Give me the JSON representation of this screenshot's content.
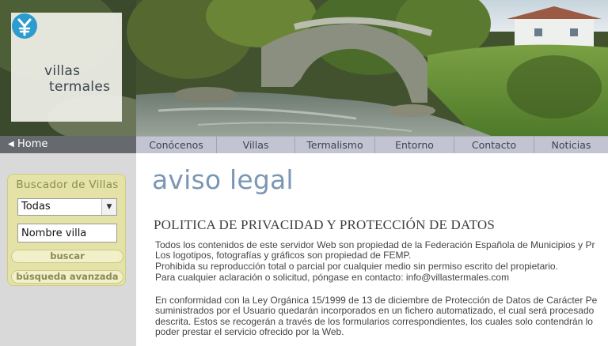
{
  "header": {
    "logo_line1": "villas",
    "logo_line2": "termales"
  },
  "nav": {
    "home_label": "Home",
    "items": [
      "Conócenos",
      "Villas",
      "Termalismo",
      "Entorno",
      "Contacto",
      "Noticias"
    ]
  },
  "sidebar": {
    "search_title": "Buscador de Villas",
    "select_value": "Todas",
    "name_input_value": "Nombre villa",
    "search_button": "buscar",
    "advanced_button": "búsqueda avanzada"
  },
  "main": {
    "title": "aviso legal",
    "heading": "POLITICA DE PRIVACIDAD Y PROTECCIÓN DE DATOS",
    "para1": [
      "Todos los contenidos de este servidor Web son propiedad de la Federación Española de Municipios y Pr",
      "Los logotipos, fotografías y gráficos son propiedad de FEMP.",
      "Prohibida su reproducción total o parcial por cualquier medio sin permiso escrito del propietario.",
      "Para cualquier aclaración o solicitud, póngase en contacto: info@villastermales.com"
    ],
    "para2": [
      "En conformidad con la Ley Orgánica 15/1999 de 13 de diciembre de Protección de Datos de Carácter Pe",
      "suministrados por el Usuario quedarán incorporados en un fichero automatizado, el cual será procesado",
      "descrita. Estos se recogerán a través de los formularios correspondientes, los cuales solo contendrán lo",
      "poder prestar el servicio ofrecido por la Web."
    ]
  },
  "colors": {
    "title_blue": "#7b97b5",
    "nav_bg": "#c2c5d1",
    "home_bg": "#666a6e",
    "search_box": "#e4e2a6",
    "sidebar_bg": "#d9d9d9",
    "logo_teal": "#2c9bd0"
  },
  "icons": {
    "logo": "villas-termales-logo-icon",
    "home_arrow": "left-triangle-icon",
    "select_arrow": "chevron-down-icon"
  }
}
